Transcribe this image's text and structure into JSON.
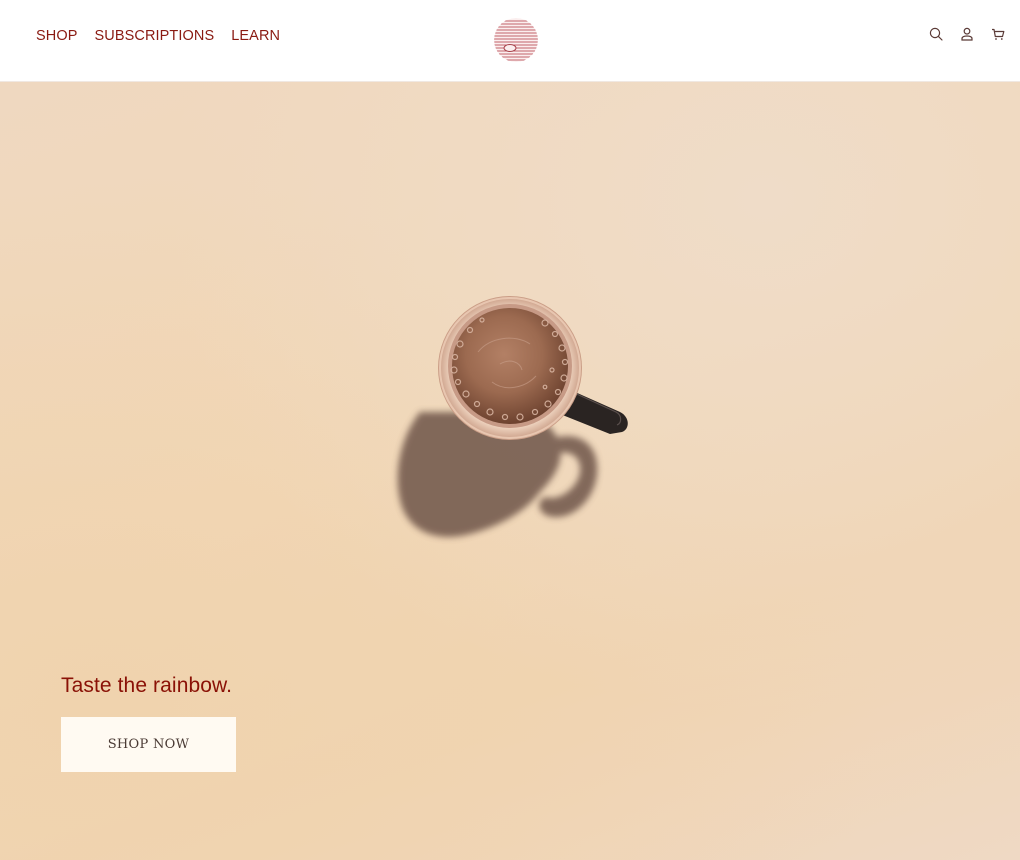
{
  "header": {
    "nav": [
      {
        "label": "SHOP"
      },
      {
        "label": "SUBSCRIPTIONS"
      },
      {
        "label": "LEARN"
      }
    ],
    "logo_icon": "striped-circle-logo",
    "icons": [
      "search-icon",
      "account-icon",
      "cart-icon"
    ]
  },
  "hero": {
    "title": "Taste the rainbow.",
    "cta_label": "SHOP NOW",
    "image": "coffee-cup-top-view"
  },
  "colors": {
    "accent": "#8a1106",
    "nav_text": "#8a1a12",
    "hero_bg": "#f0d6b6",
    "button_bg": "#fffaf2"
  }
}
